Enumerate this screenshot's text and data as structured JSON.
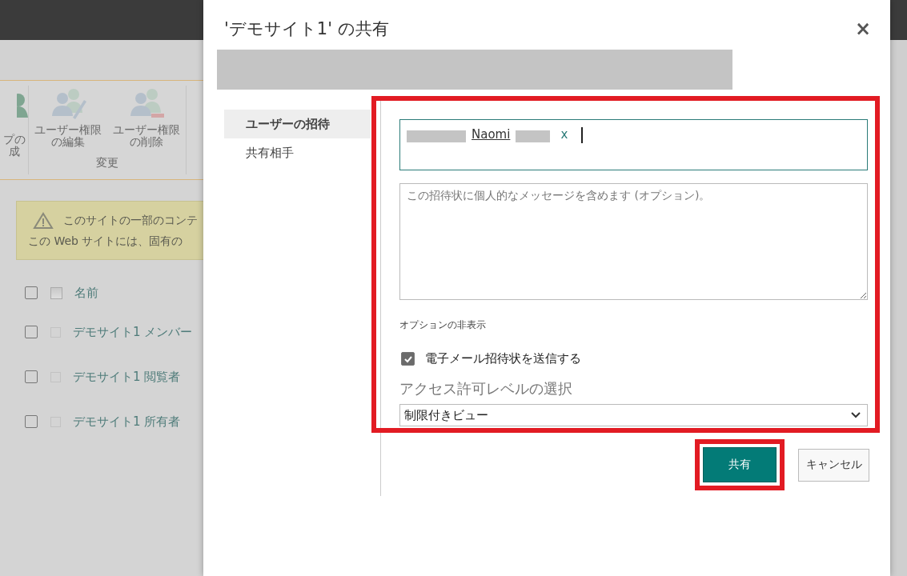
{
  "background": {
    "ribbon": {
      "partial_item": {
        "lines": [
          "プの",
          "成"
        ]
      },
      "groups": [
        {
          "label": "変更",
          "items": [
            {
              "kind": "edit",
              "lines": [
                "ユーザー権限",
                "の編集"
              ]
            },
            {
              "kind": "remove",
              "lines": [
                "ユーザー権限",
                "の削除"
              ]
            }
          ]
        }
      ]
    },
    "warning": {
      "lines": [
        "このサイトの一部のコンテ",
        "この Web サイトには、固有の"
      ]
    },
    "list": {
      "header": {
        "label": "名前",
        "checked": false
      },
      "rows": [
        {
          "name": "デモサイト1 メンバー",
          "checked": false
        },
        {
          "name": "デモサイト1 閲覧者",
          "checked": false
        },
        {
          "name": "デモサイト1 所有者",
          "checked": false
        }
      ]
    }
  },
  "dialog": {
    "title": "'デモサイト1' の共有",
    "close": "×",
    "nav": [
      {
        "label": "ユーザーの招待",
        "selected": true
      },
      {
        "label": "共有相手",
        "selected": false
      }
    ],
    "invite": {
      "highlighted": true,
      "chip": {
        "name": "Naomi",
        "remove": "x"
      },
      "message": {
        "placeholder": "この招待状に個人的なメッセージを含めます (オプション)。"
      },
      "options_toggle": "オプションの非表示",
      "send_email": {
        "label": "電子メール招待状を送信する",
        "checked": true
      },
      "permission": {
        "label": "アクセス許可レベルの選択",
        "value": "制限付きビュー"
      }
    },
    "buttons": [
      {
        "kind": "primary",
        "label": "共有",
        "highlighted": true
      },
      {
        "kind": "secondary",
        "label": "キャンセル",
        "highlighted": false
      }
    ]
  }
}
